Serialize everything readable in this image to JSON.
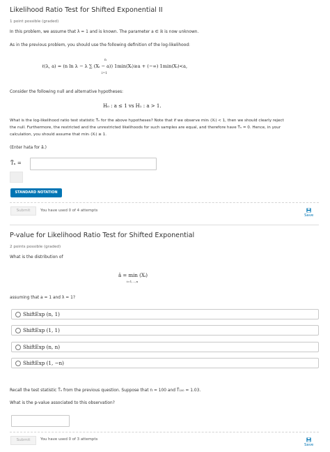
{
  "problem1": {
    "title": "Likelihood Ratio Test for Shifted Exponential II",
    "points": "1 point possible (graded)",
    "intro": "In this problem, we assume that λ = 1 and is known. The parameter a ∈ ℝ is now unknown.",
    "instruction": "As in the previous problem, you should use the following definition of the log-likelihood:",
    "formula": "ℓ(λ, a) = (n ln λ − λ ∑ (Xᵢ − a)) 1min(Xᵢ)≥a + (−∞) 1min(Xᵢ)<a,",
    "formula_sum_top": "n",
    "formula_sum_bottom": "i=1",
    "consider": "Consider the following null and alternative hypotheses:",
    "hypotheses": "H₀ : a ≤ 1   vs   H₁ : a > 1.",
    "question_line1": "What is the log-likelihood ratio test statistic T̃ₙ for the above hypotheses? Note that if we observe minᵢ (Xᵢ) < 1, then we should clearly reject",
    "question_line2": "the null. Furthermore, the restricted and the unrestricted likelihoods for such samples are equal, and therefore have T̃ₙ = 0. Hence, in your",
    "question_line3": "calculation, you should assume that minᵢ (Xᵢ) ≥ 1.",
    "enter_hint": "(Enter hata for â.)",
    "answer_label": "T̃ₙ =",
    "answer_value": "",
    "standard_notation_label": "STANDARD NOTATION",
    "submit_label": "Submit",
    "attempts_text": "You have used 0 of 4 attempts",
    "save_label": "Save"
  },
  "problem2": {
    "title": "P-value for Likelihood Ratio Test for Shifted Exponential",
    "points": "2 points possible (graded)",
    "question": "What is the distribution of",
    "estimator": "â = min (Xᵢ)",
    "estimator_sub": "i=1,...,n",
    "assuming": "assuming that a = 1 and λ = 1?",
    "options": [
      "ShiftExp (n, 1)",
      "ShiftExp (1, 1)",
      "ShiftExp (n, n)",
      "ShiftExp (1, −n)"
    ],
    "recall": "Recall the test statistic T̃ₙ from the previous question. Suppose that n = 100 and T̃₁₀₀ = 1.03.",
    "pvalue_question": "What is the p-value associated to this observation?",
    "answer_value": "",
    "submit_label": "Submit",
    "attempts_text": "You have used 0 of 3 attempts",
    "save_label": "Save"
  },
  "colors": {
    "accent": "#0075b4",
    "text": "#313131",
    "border": "#c8c8c8"
  },
  "icons": {
    "save": "save-icon"
  }
}
